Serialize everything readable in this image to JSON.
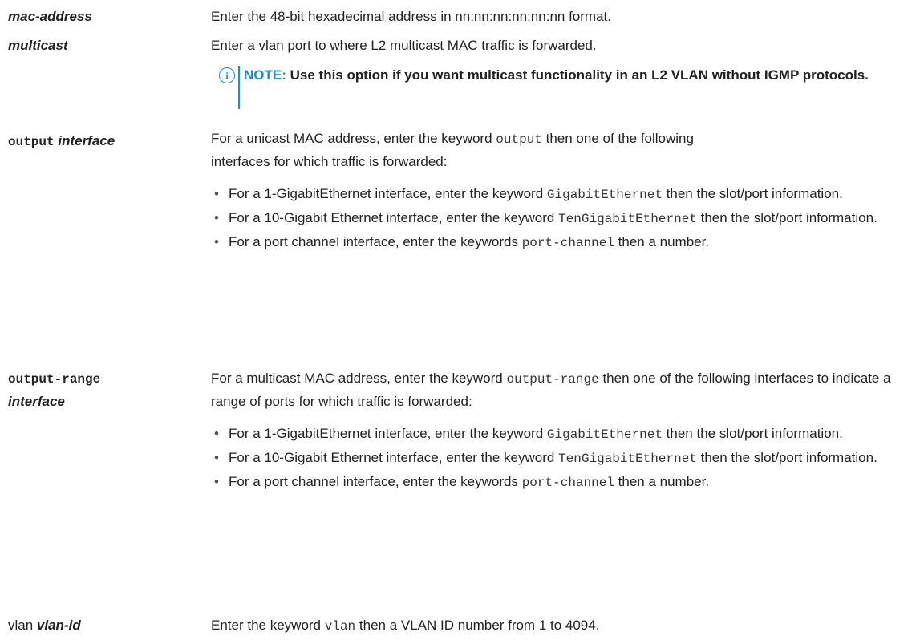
{
  "rows": {
    "mac": {
      "term": "mac-address",
      "desc": "Enter the 48-bit hexadecimal address in nn:nn:nn:nn:nn:nn format."
    },
    "multicast": {
      "term": "multicast",
      "desc": "Enter a vlan port to where L2 multicast MAC traffic is forwarded."
    },
    "note": {
      "label": "NOTE:",
      "text": "Use this option if you want multicast functionality in an L2 VLAN without IGMP protocols.",
      "icon": "info-icon"
    },
    "output": {
      "term_kw": "output",
      "term_arg": "interface",
      "desc_a": "For a unicast MAC address, enter the keyword",
      "desc_kw": "output",
      "desc_b": "then one of the following interfaces for which traffic is forwarded:",
      "items": [
        {
          "a": "For a 1-GigabitEthernet interface, enter the keyword",
          "kw": "GigabitEthernet",
          "b": "then the slot/port information."
        },
        {
          "a": "For a 10-Gigabit Ethernet interface, enter the keyword",
          "kw": "TenGigabitEthernet",
          "b": "then the slot/port information."
        },
        {
          "a": "For a port channel interface, enter the keywords",
          "kw": "port-channel",
          "b": "then a number."
        }
      ]
    },
    "range": {
      "term_kw": "output-range",
      "term_arg": "interface",
      "desc_a": "For a multicast MAC address, enter the keyword",
      "desc_kw": "output-range",
      "desc_b": "then one of the following interfaces to indicate a range of ports for which traffic is forwarded:",
      "items": [
        {
          "a": "For a 1-GigabitEthernet interface, enter the keyword",
          "kw": "GigabitEthernet",
          "b": "then the slot/port information."
        },
        {
          "a": "For a 10-Gigabit Ethernet interface, enter the keyword",
          "kw": "TenGigabitEthernet",
          "b": "then the slot/port information."
        },
        {
          "a": "For a port channel interface, enter the keywords",
          "kw": "port-channel",
          "b": "then a number."
        }
      ]
    },
    "vlan": {
      "term_kw": "vlan",
      "term_arg": "vlan-id",
      "desc_a": "Enter the keyword",
      "desc_kw": "vlan",
      "desc_b": "then a VLAN ID number from 1 to 4094."
    }
  },
  "bullet": "•",
  "colors": {
    "accent": "#1a8fd0",
    "text": "#222222"
  }
}
